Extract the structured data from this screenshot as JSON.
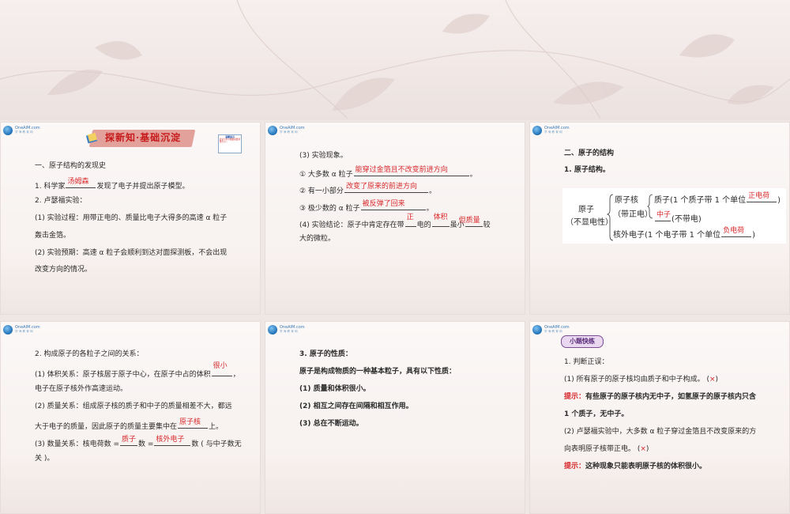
{
  "slides": {
    "s1": {
      "header": "探新知·基础沉淀",
      "sticker_title": "温馨提示",
      "sticker_text": "此幻灯片可根据需要调整大小...",
      "h1": "一、原子结构的发现史",
      "l1_pre": "1. 科学家",
      "l1_ans": "汤姆森",
      "l1_post": "发现了电子并提出原子模型。",
      "l2": "2. 卢瑟福实验：",
      "l3": "(1) 实验过程：用带正电的、质量比电子大得多的高速 α 粒子",
      "l4": "轰击金箔。",
      "l5": "(2) 实验预期：高速 α 粒子会顺利到达对面探测板，不会出现",
      "l6": "改变方向的情况。"
    },
    "s2": {
      "l1": "(3) 实验现象。",
      "l2_pre": "① 大多数 α 粒子",
      "l2_ans": "能穿过金箔且不改变前进方向",
      "l2_post": "。",
      "l3_pre": "② 有一小部分",
      "l3_ans": "改变了原来的前进方向",
      "l3_post": "。",
      "l4_pre": "③ 极少数的 α 粒子",
      "l4_ans": "被反弹了回来",
      "l4_post": "。",
      "l5_a": "(4) 实验结论：原子中肯定存在带",
      "l5_ans1": "正",
      "l5_b": "电的",
      "l5_ans2": "体积",
      "l5_c": "虽小",
      "l5_ans3": "但质量",
      "l5_d": "较",
      "l6": "大的微粒。"
    },
    "s3": {
      "h1": "二、原子的结构",
      "h2": "1. 原子结构。",
      "atom": "原子",
      "neutral": "（不显电性）",
      "nucleus": "原子核",
      "nucleus_charge": "（带正电）",
      "proton_pre": "质子(1 个质子带 1 个单位",
      "proton_ans": "正电荷",
      "proton_post": ")",
      "neutron_ans": "中子",
      "neutron_post": "(不带电)",
      "electron_pre": "核外电子(1 个电子带 1 个单位",
      "electron_ans": "负电荷",
      "electron_post": ")"
    },
    "s4": {
      "l1": "2. 构成原子的各粒子之间的关系：",
      "l2_pre": "(1) 体积关系：原子核居于原子中心，在原子中占的体积",
      "l2_ans": "很小",
      "l2_post": "，",
      "l3": "电子在原子核外作高速运动。",
      "l4": "(2) 质量关系：组成原子核的质子和中子的质量相差不大，都远",
      "l5_pre": "大于电子的质量，因此原子的质量主要集中在",
      "l5_ans": "原子核",
      "l5_post": "上。",
      "l6_pre": "(3) 数量关系：核电荷数 =",
      "l6_ans1": "质子",
      "l6_mid": "数 =",
      "l6_ans2": "核外电子",
      "l6_post": "数 ( 与中子数无",
      "l7": "关 )。"
    },
    "s5": {
      "l1": "3. 原子的性质：",
      "l2": "原子是构成物质的一种基本粒子，具有以下性质：",
      "l3": "(1) 质量和体积很小。",
      "l4": "(2) 相互之间存在间隔和相互作用。",
      "l5": "(3) 总在不断运动。"
    },
    "s6": {
      "badge": "小题快练",
      "l1": "1. 判断正误：",
      "l2_pre": "(1) 所有原子的原子核均由质子和中子构成。 (",
      "l2_mark": "×",
      "l2_post": ")",
      "l3_lbl": "提示：",
      "l3": "有些原子的原子核内无中子，如氢原子的原子核内只含",
      "l4": "1 个质子，无中子。",
      "l5": "(2) 卢瑟福实验中，大多数 α 粒子穿过金箔且不改变原来的方",
      "l6_pre": "向表明原子核带正电。 (",
      "l6_mark": "×",
      "l6_post": ")",
      "l7_lbl": "提示：",
      "l7": "这种现象只能表明原子核的体积很小。"
    }
  },
  "logo": {
    "brand": "OneAIM.com",
    "sub": "学 海 教 育 网"
  }
}
